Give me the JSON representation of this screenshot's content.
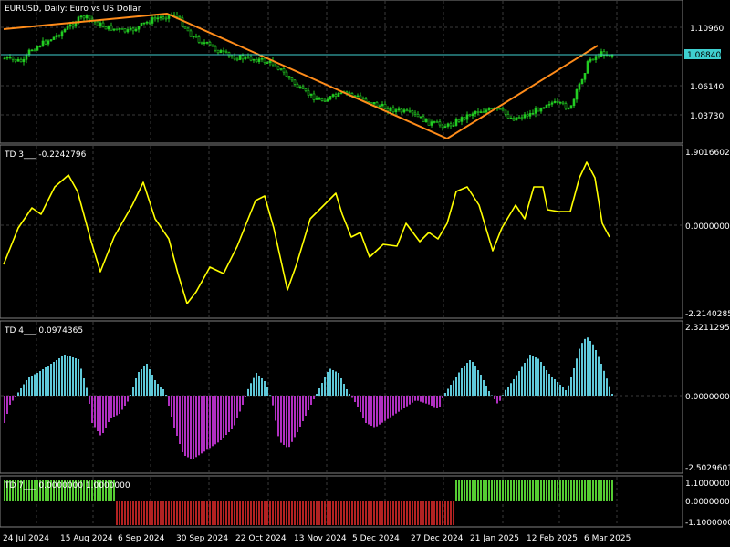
{
  "panes": {
    "main": {
      "title": "EURUSD, Daily:  Euro vs US Dollar",
      "price_labels": [
        "1.10960",
        "1.06140",
        "1.03730"
      ],
      "current_price": "1.08840",
      "colors": {
        "bull": "#22cc22",
        "bear": "#000000",
        "wick": "#22cc22",
        "trend": "#ff8c1a",
        "hline": "#3fd0d0"
      }
    },
    "td3": {
      "title": "TD 3___ -0.2242796",
      "labels": [
        "1.9016602",
        "0.0000000",
        "-2.2140285"
      ],
      "color": "#ffff00"
    },
    "td4": {
      "title": "TD 4___ 0.0974365",
      "labels": [
        "2.3211295",
        "0.0000000",
        "-2.5029601"
      ],
      "colors": {
        "pos": "#5fc8d8",
        "neg": "#b030c0"
      }
    },
    "td7": {
      "title": "TD 7___ 0.0000000 1.0000000",
      "labels": [
        "1.1000000",
        "0.0000000",
        "-1.1000000"
      ],
      "colors": {
        "pos": "#55cc33",
        "neg": "#b22222"
      }
    }
  },
  "time_axis": [
    "24 Jul 2024",
    "15 Aug 2024",
    "6 Sep 2024",
    "30 Sep 2024",
    "22 Oct 2024",
    "13 Nov 2024",
    "5 Dec 2024",
    "27 Dec 2024",
    "21 Jan 2025",
    "12 Feb 2025",
    "6 Mar 2025"
  ],
  "chart_data": [
    {
      "type": "line",
      "name": "EURUSD Daily close",
      "x": [
        "24 Jul 2024",
        "15 Aug 2024",
        "6 Sep 2024",
        "30 Sep 2024",
        "22 Oct 2024",
        "13 Nov 2024",
        "5 Dec 2024",
        "27 Dec 2024",
        "21 Jan 2025",
        "12 Feb 2025",
        "6 Mar 2025"
      ],
      "y": [
        1.085,
        1.1,
        1.11,
        1.115,
        1.085,
        1.06,
        1.053,
        1.04,
        1.045,
        1.04,
        1.085
      ],
      "ylim": [
        1.02,
        1.125
      ],
      "trendlines": [
        {
          "from": [
            "24 Jul 2024",
            1.105
          ],
          "to": [
            "30 Sep 2024",
            1.12
          ]
        },
        {
          "from": [
            "30 Sep 2024",
            1.12
          ],
          "to": [
            "27 Dec 2024",
            1.025
          ]
        },
        {
          "from": [
            "27 Dec 2024",
            1.025
          ],
          "to": [
            "6 Mar 2025",
            1.095
          ]
        }
      ],
      "hline": 1.0884
    },
    {
      "type": "line",
      "name": "TD 3",
      "ylim": [
        -2.2140285,
        1.9016602
      ]
    },
    {
      "type": "bar",
      "name": "TD 4",
      "ylim": [
        -2.5029601,
        2.3211295
      ]
    },
    {
      "type": "bar",
      "name": "TD 7",
      "ylim": [
        -1.1,
        1.1
      ]
    }
  ]
}
